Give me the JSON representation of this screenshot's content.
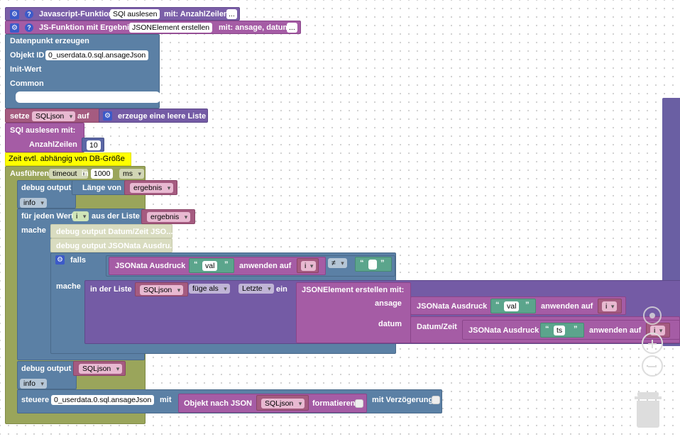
{
  "header": {
    "js_function_label": "Javascript-Funktion",
    "js_function_name": "SQl auslesen",
    "js_function_params": "mit: AnzahlZeilen",
    "js_result_function_label": "JS-Funktion mit Ergebnis",
    "js_result_function_name": "JSONElement erstellen",
    "js_result_function_params": "mit: ansage, datum",
    "more": "..."
  },
  "create_state": {
    "title": "Datenpunkt erzeugen",
    "object_id_label": "Objekt ID",
    "object_id_value": "0_userdata.0.sql.ansageJson",
    "init_label": "Init-Wert",
    "common_label": "Common"
  },
  "set_var": {
    "label": "setze",
    "var": "SQLjson",
    "auf": "auf",
    "create_list": "erzeuge eine leere Liste"
  },
  "call_fn": {
    "label": "SQl auslesen  mit:",
    "param_label": "AnzahlZeilen",
    "param_value": "10"
  },
  "comment": "Zeit evtl. abhängig von DB-Größe",
  "timeout": {
    "label": "Ausführen",
    "type": "timeout",
    "in": "in",
    "value": "1000",
    "unit": "ms"
  },
  "debug1": {
    "label": "debug output",
    "len_label": "Länge von",
    "var": "ergebnis",
    "level": "info"
  },
  "foreach": {
    "label": "für jeden Wert",
    "var": "i",
    "from_list": "aus der Liste",
    "list_var": "ergebnis",
    "do_label": "mache"
  },
  "disabled_debug": {
    "line1": "debug output Datum/Zeit JSO...",
    "line2": "debug output JSONata Ausdru..."
  },
  "if_block": {
    "falls": "falls",
    "mache": "mache",
    "jsonata_label": "JSONata Ausdruck",
    "val_text": "val",
    "anwenden_auf": "anwenden auf",
    "var_i": "i",
    "neq": "≠",
    "empty_quote_left": "“",
    "empty_quote_right": "”"
  },
  "list_insert": {
    "in_list": "in der Liste",
    "list_var": "SQLjson",
    "insert_as": "füge als",
    "position": "Letzte",
    "ein": "ein",
    "fn_label": "JSONElement erstellen  mit:",
    "ansage_label": "ansage",
    "datum_label": "datum",
    "jsonata_label": "JSONata Ausdruck",
    "val_text": "val",
    "anwenden_auf": "anwenden auf",
    "var_i": "i",
    "datetime_label": "Datum/Zeit",
    "ts_text": "ts"
  },
  "debug2": {
    "label": "debug output",
    "var": "SQLjson",
    "level": "info"
  },
  "control": {
    "label": "steuere",
    "object_id": "0_userdata.0.sql.ansageJson",
    "mit": "mit",
    "obj_to_json": "Objekt nach JSON",
    "var": "SQLjson",
    "format_label": "formatieren",
    "delay_label": "mit Verzögerung"
  },
  "workspace_controls": {
    "zoom_in_icon": "zoom-in-icon",
    "zoom_out_icon": "zoom-out-icon",
    "reset_icon": "zoom-reset-icon",
    "trash_icon": "trash-icon"
  }
}
